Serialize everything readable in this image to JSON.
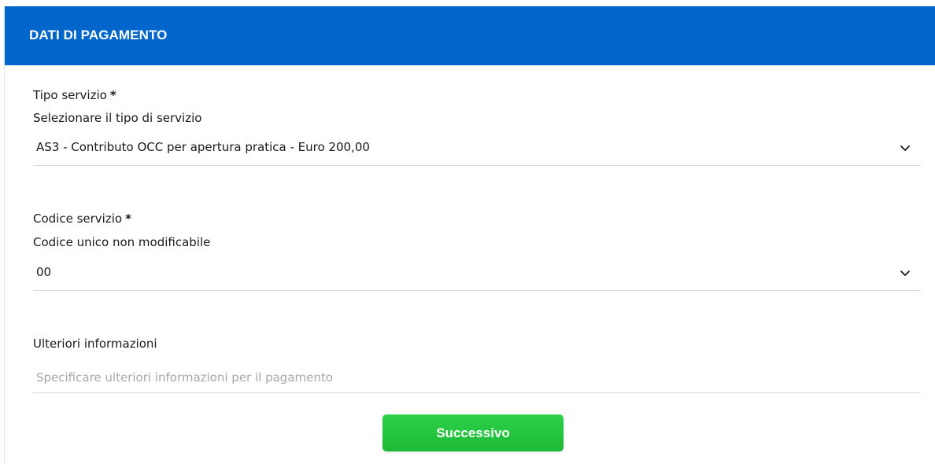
{
  "header": {
    "title": "DATI DI PAGAMENTO"
  },
  "service_type": {
    "label": "Tipo servizio",
    "required_mark": "*",
    "hint": "Selezionare il tipo di servizio",
    "selected_value": "AS3 - Contributo OCC per apertura pratica - Euro 200,00",
    "icon": "chevron-down-icon"
  },
  "service_code": {
    "label": "Codice servizio",
    "required_mark": "*",
    "hint": "Codice unico non modificabile",
    "selected_value": "00",
    "icon": "chevron-down-icon"
  },
  "additional_info": {
    "label": "Ulteriori informazioni",
    "placeholder": "Specificare ulteriori informazioni per il pagamento",
    "value": ""
  },
  "actions": {
    "next_label": "Successivo"
  },
  "colors": {
    "header_bg": "#0066cc",
    "button_bg": "#22c23c",
    "placeholder_text": "#a8a8a8"
  }
}
